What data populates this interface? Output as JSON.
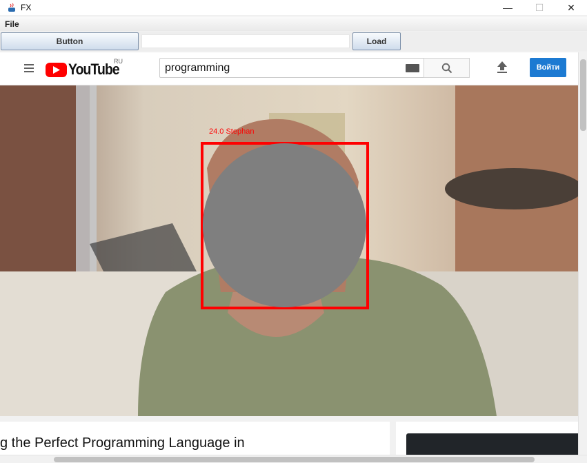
{
  "window": {
    "title": "FX"
  },
  "menu": {
    "file": "File"
  },
  "toolbar": {
    "button_label": "Button",
    "url_value": "",
    "load_label": "Load"
  },
  "youtube": {
    "logo_text": "YouTube",
    "region": "RU",
    "search_value": "programming",
    "signin_label": "Войти"
  },
  "detection": {
    "label": "24.0  Stephan"
  },
  "video": {
    "title": "g the Perfect Programming Language in"
  },
  "colors": {
    "accent_red": "#ff0000",
    "signin_blue": "#1c7ad2",
    "mask_gray": "#7f7f7f"
  }
}
